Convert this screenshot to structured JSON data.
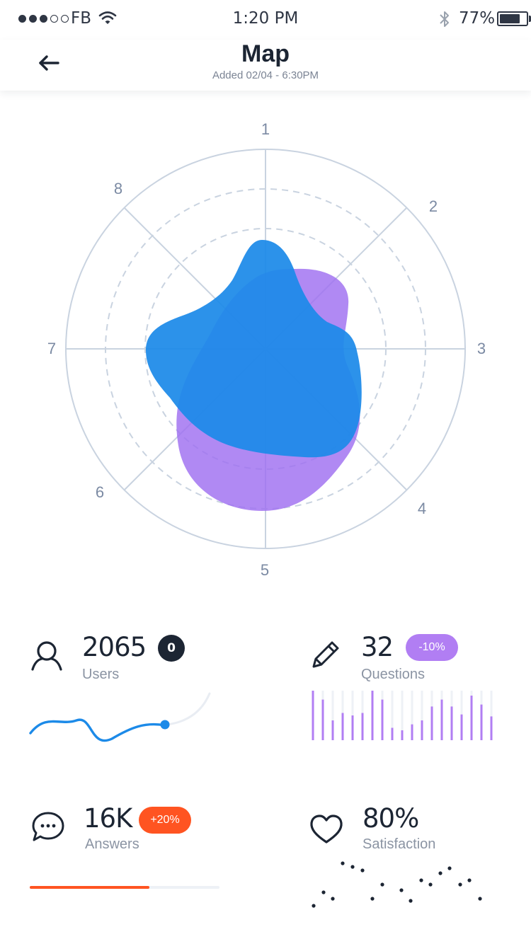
{
  "status_bar": {
    "carrier": "FB",
    "time": "1:20 PM",
    "battery_percent": "77%",
    "battery_level": 0.77,
    "signal_strength": 3,
    "signal_max": 5
  },
  "nav": {
    "back_icon": "arrow-left-icon",
    "title": "Map",
    "subtitle": "Added 02/04 - 6:30PM"
  },
  "radar": {
    "axis_labels": [
      "1",
      "2",
      "3",
      "4",
      "5",
      "6",
      "7",
      "8"
    ],
    "colors": {
      "series_a": "#9f6ff0",
      "series_b": "#1c8ae8",
      "grid": "#c9d3e0"
    }
  },
  "stats": {
    "users": {
      "icon": "user-icon",
      "value": "2065",
      "badge": "0",
      "label": "Users"
    },
    "questions": {
      "icon": "pencil-icon",
      "value": "32",
      "badge": "-10%",
      "label": "Questions"
    },
    "answers": {
      "icon": "chat-bubble-icon",
      "value": "16K",
      "badge": "+20%",
      "label": "Answers",
      "progress": 0.63
    },
    "satisfaction": {
      "icon": "heart-icon",
      "value": "80%",
      "label": "Satisfaction"
    }
  },
  "colors": {
    "blue": "#1c8ae8",
    "purple": "#b17ef3",
    "orange": "#ff5421",
    "dark": "#1c2533"
  }
}
